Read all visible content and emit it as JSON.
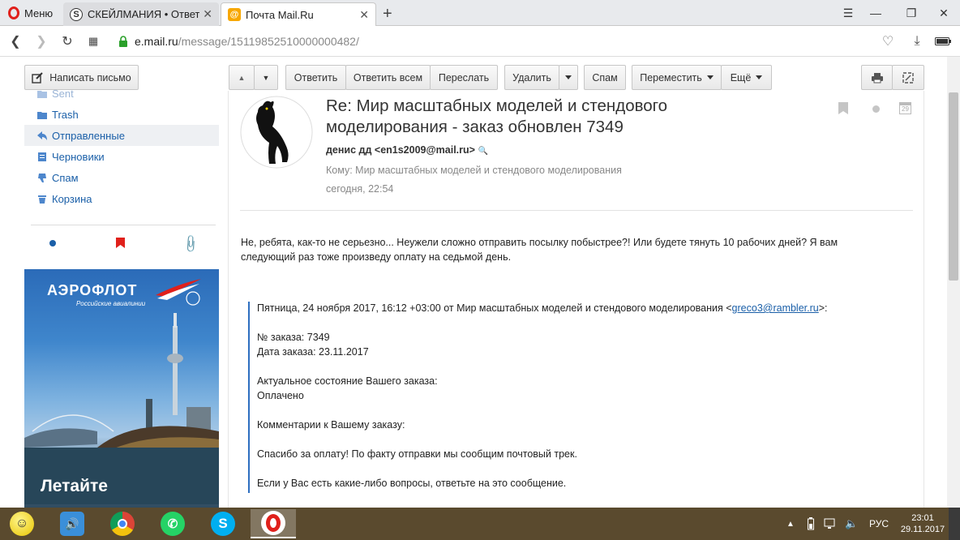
{
  "browser": {
    "menu_label": "Меню",
    "tabs": [
      {
        "title": "СКЕЙЛМАНИЯ • Ответить",
        "favicon": "S"
      },
      {
        "title": "Почта Mail.Ru",
        "favicon": "@"
      }
    ],
    "url_host": "e.mail.ru",
    "url_path": "/message/15119852510000000482/"
  },
  "toolbar": {
    "compose": "Написать письмо",
    "reply": "Ответить",
    "reply_all": "Ответить всем",
    "forward": "Переслать",
    "delete": "Удалить",
    "spam": "Спам",
    "move": "Переместить",
    "more": "Ещё"
  },
  "folders": [
    {
      "label": "Sent",
      "icon": "folder-icon"
    },
    {
      "label": "Trash",
      "icon": "folder-icon"
    },
    {
      "label": "Отправленные",
      "icon": "sent-icon",
      "active": true
    },
    {
      "label": "Черновики",
      "icon": "drafts-icon"
    },
    {
      "label": "Спам",
      "icon": "spam-icon"
    },
    {
      "label": "Корзина",
      "icon": "trash-icon"
    }
  ],
  "ad": {
    "brand": "АЭРОФЛОТ",
    "sub": "Российские авиалинии",
    "headline": "Летайте"
  },
  "message": {
    "subject_line1": "Re: Мир масштабных моделей и стендового",
    "subject_line2": "моделирования - заказ обновлен 7349",
    "from": "денис дд <en1s2009@mail.ru>",
    "to": "Кому: Мир масштабных моделей и стендового моделирования",
    "date": "сегодня, 22:54",
    "body_line1": "Не, ребята, как-то не серьезно... Неужели сложно отправить посылку побыстрее?! Или будете тянуть 10 рабочих дней? Я вам",
    "body_line2": "следующий раз тоже произведу оплату на седьмой день.",
    "quote_header_pre": "Пятница, 24 ноября 2017, 16:12 +03:00 от Мир масштабных моделей и стендового моделирования <",
    "quote_email": "greco3@rambler.ru",
    "quote_header_post": ">:",
    "order_no": "№ заказа: 7349",
    "order_date": "Дата заказа: 23.11.2017",
    "status_label": "Актуальное состояние Вашего заказа:",
    "status_value": "Оплачено",
    "comments_label": "Комментарии к Вашему заказу:",
    "comment1": "Спасибо за оплату! По факту отправки мы сообщим почтовый трек.",
    "comment2": "Если у Вас есть какие-либо вопросы, ответьте на это сообщение.",
    "calendar_day": "29"
  },
  "taskbar": {
    "lang": "РУС",
    "time": "23:01",
    "date": "29.11.2017"
  }
}
